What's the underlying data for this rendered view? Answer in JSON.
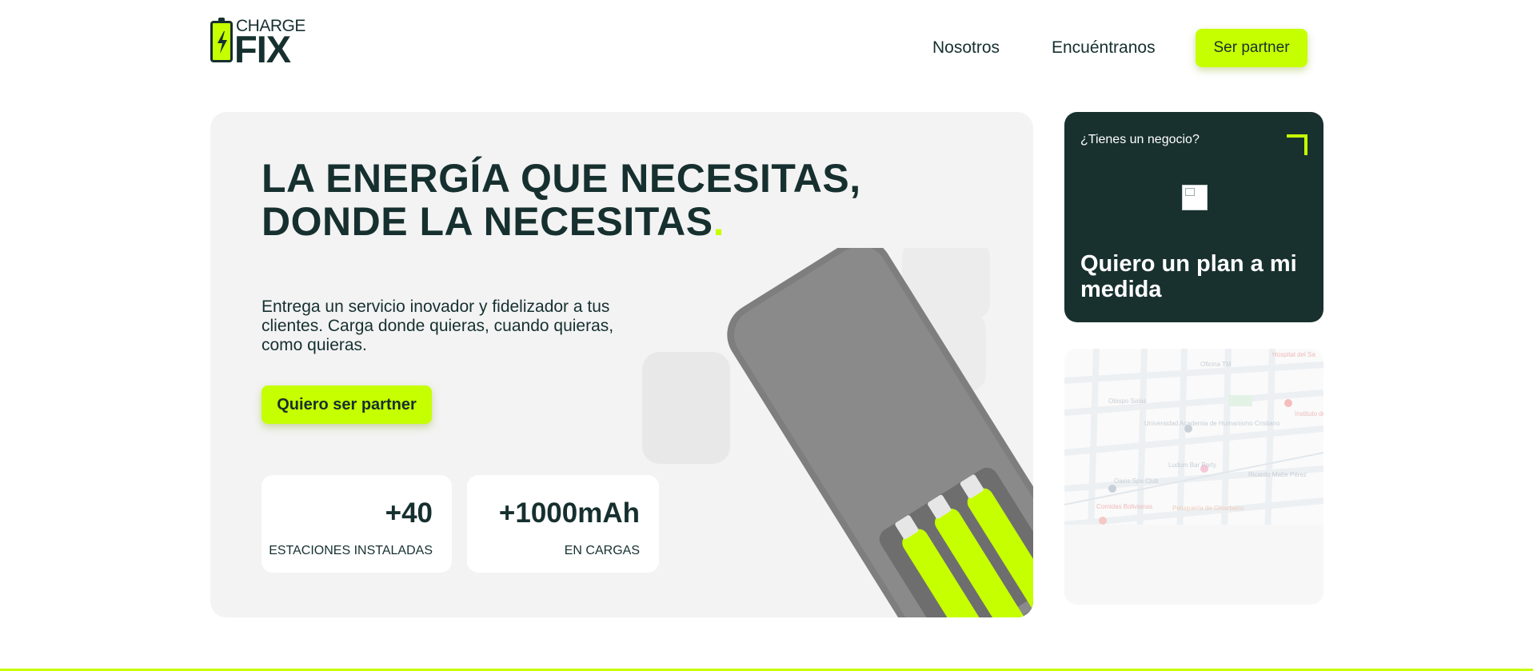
{
  "brand": {
    "charge": "CHARGE",
    "fix": "FIX",
    "accent_color": "#c6ff00",
    "dark_color": "#16302f",
    "icon": "battery-bolt-icon"
  },
  "nav": {
    "nosotros": "Nosotros",
    "encuentranos": "Encuéntranos",
    "partner_button": "Ser partner"
  },
  "hero": {
    "title_line1": "LA ENERGÍA QUE NECESITAS,",
    "title_line2": "DONDE LA NECESITAS",
    "title_dot": ".",
    "description": "Entrega un servicio inovador y fidelizador a tus clientes. Carga donde quieras, cuando quieras, como quieras.",
    "cta": "Quiero ser partner",
    "stats": [
      {
        "value": "+40",
        "label": "ESTACIONES INSTALADAS"
      },
      {
        "value": "+1000mAh",
        "label": "EN CARGAS"
      }
    ],
    "illustration": "power-bank-image"
  },
  "business_card": {
    "question": "¿Tienes un negocio?",
    "heading": "Quiero un plan a mi medida",
    "corner_icon": "corner-arrow-icon",
    "image": "broken-image-icon"
  },
  "map": {
    "labels": {
      "hospital": "Hospital del Sa",
      "oficina": "Oficina TM",
      "obispo": "Obispo Salas",
      "universidad": "Universidad Academia de Humanismo Cristiano",
      "instituto": "Instituto de la",
      "ludum": "Ludum Bar Party",
      "ricardo": "Ricardo Matte Pérez",
      "oasis": "Oasis Spa Club",
      "comidas": "Comidas Bolivianas",
      "peluqueria": "Peluquería de Ghiarbano"
    }
  }
}
